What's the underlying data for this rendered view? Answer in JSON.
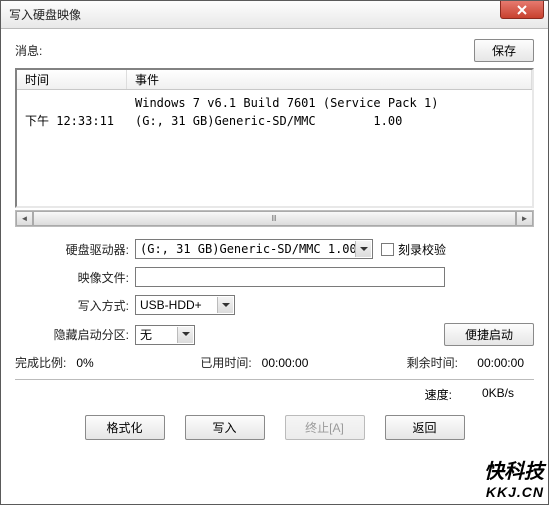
{
  "window": {
    "title": "写入硬盘映像"
  },
  "header": {
    "message_label": "消息:",
    "save_btn": "保存"
  },
  "log": {
    "columns": {
      "time": "时间",
      "event": "事件"
    },
    "rows": [
      {
        "time": "",
        "event": "Windows 7 v6.1 Build 7601 (Service Pack 1)"
      },
      {
        "time": "下午 12:33:11",
        "event": "(G:, 31 GB)Generic-SD/MMC        1.00"
      }
    ]
  },
  "form": {
    "drive_label": "硬盘驱动器:",
    "drive_value": "(G:, 31 GB)Generic-SD/MMC      1.00",
    "burn_check_label": "刻录校验",
    "image_label": "映像文件:",
    "image_value": "",
    "write_mode_label": "写入方式:",
    "write_mode_value": "USB-HDD+",
    "hidden_boot_label": "隐藏启动分区:",
    "hidden_boot_value": "无",
    "convenient_boot_btn": "便捷启动"
  },
  "status": {
    "done_ratio_label": "完成比例:",
    "done_ratio_value": "0%",
    "elapsed_label": "已用时间:",
    "elapsed_value": "00:00:00",
    "remaining_label": "剩余时间:",
    "remaining_value": "00:00:00",
    "speed_label": "速度:",
    "speed_value": "0KB/s"
  },
  "buttons": {
    "format": "格式化",
    "write": "写入",
    "abort": "终止[A]",
    "back": "返回"
  },
  "watermark": {
    "cn": "快科技",
    "url": "KKJ.CN"
  }
}
